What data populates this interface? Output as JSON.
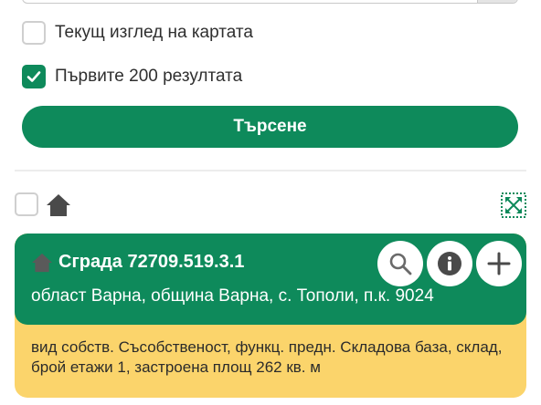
{
  "options": {
    "current_view_label": "Текущ изглед на картата",
    "current_view_checked": false,
    "first200_label": "Първите 200 резултата",
    "first200_checked": true
  },
  "search_button": {
    "label": "Търсене"
  },
  "result": {
    "title": "Сграда 72709.519.3.1",
    "address": "област Варна, община Варна, с. Тополи, п.к. 9024",
    "details": "вид собств. Съсобственост, функц. предн. Складова база, склад, брой етажи 1, застроена площ 262 кв. м"
  },
  "icons": {
    "home": "home-icon",
    "expand": "expand-icon",
    "search": "magnifier-icon",
    "info": "info-icon",
    "add": "plus-icon",
    "check": "checkmark-icon"
  },
  "colors": {
    "primary": "#0e8a5b",
    "details_bg": "#fbd46b",
    "icon_dark": "#4a4a4a"
  }
}
